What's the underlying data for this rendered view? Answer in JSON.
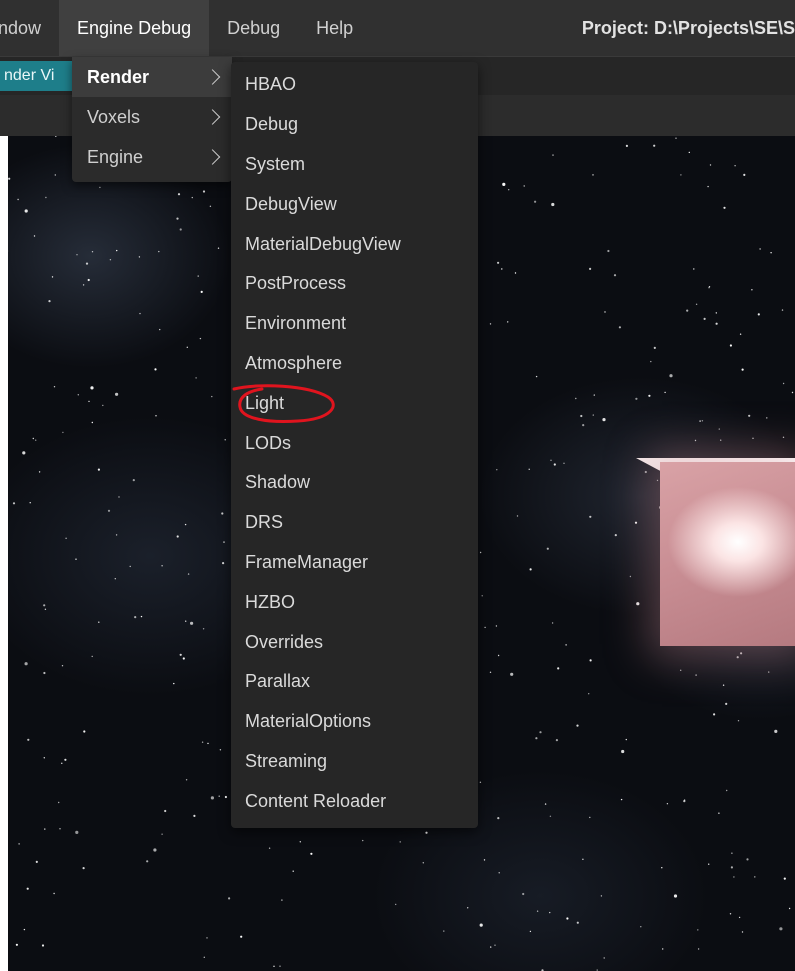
{
  "menubar": {
    "items": [
      {
        "label": "ndow"
      },
      {
        "label": "Engine Debug"
      },
      {
        "label": "Debug"
      },
      {
        "label": "Help"
      }
    ],
    "project_path": "Project: D:\\Projects\\SE\\S"
  },
  "tabbar": {
    "active_tab_label": "nder Vi",
    "active_tab_color": "#1e7e8a"
  },
  "engine_debug_menu": {
    "items": [
      {
        "label": "Render",
        "icon": "chevron-right-icon",
        "active": true
      },
      {
        "label": "Voxels",
        "icon": "chevron-right-icon",
        "active": false
      },
      {
        "label": "Engine",
        "icon": "chevron-right-icon",
        "active": false
      }
    ]
  },
  "render_submenu": {
    "items": [
      "HBAO",
      "Debug",
      "System",
      "DebugView",
      "MaterialDebugView",
      "PostProcess",
      "Environment",
      "Atmosphere",
      "Light",
      "LODs",
      "Shadow",
      "DRS",
      "FrameManager",
      "HZBO",
      "Overrides",
      "Parallax",
      "MaterialOptions",
      "Streaming",
      "Content Reloader"
    ],
    "highlighted_item": "Light",
    "annotation_color": "#e0141e"
  },
  "colors": {
    "menubar_bg": "#303030",
    "menu_bg": "#2b2b2b",
    "cube_glow": "#e8b0b5"
  }
}
